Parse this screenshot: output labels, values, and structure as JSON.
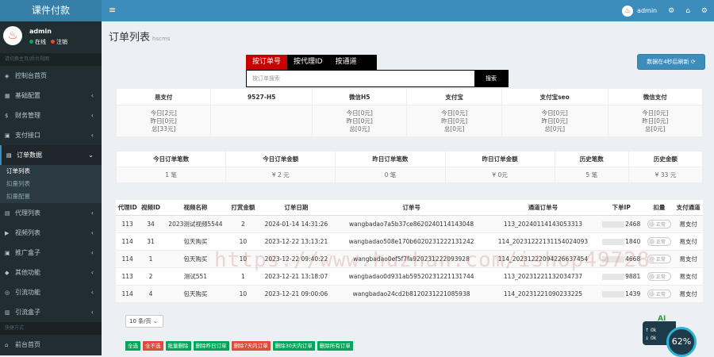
{
  "app": {
    "brand": "课件付款",
    "user": "admin"
  },
  "sidebar": {
    "user_name": "admin",
    "status_online": "在线",
    "status_logout": "注销",
    "section_main": "请切换主页/后台视图",
    "items": [
      {
        "label": "控制台首页",
        "icon": "dashboard-icon"
      },
      {
        "label": "基础配置",
        "icon": "settings-icon"
      },
      {
        "label": "财务管理",
        "icon": "finance-icon"
      },
      {
        "label": "支付接口",
        "icon": "payment-icon"
      },
      {
        "label": "订单数据",
        "icon": "order-icon"
      },
      {
        "label": "代理列表",
        "icon": "agent-icon"
      },
      {
        "label": "视频列表",
        "icon": "video-icon"
      },
      {
        "label": "推广盒子",
        "icon": "promo-icon"
      },
      {
        "label": "其他功能",
        "icon": "other-icon"
      },
      {
        "label": "引流功能",
        "icon": "traffic-icon"
      },
      {
        "label": "引流盒子",
        "icon": "box-icon"
      }
    ],
    "sub_items": [
      "订单列表",
      "扣量列表",
      "扣量配置"
    ],
    "section_quick": "快捷方式",
    "front_home": "前台首页"
  },
  "page": {
    "title": "订单列表",
    "subtitle": "hscms"
  },
  "search": {
    "tabs": [
      "按订单号",
      "按代理ID",
      "按通道"
    ],
    "placeholder": "按订单搜索",
    "button": "搜索"
  },
  "refresh_button": "数据在4秒后刷新",
  "pay_channels": {
    "headers": [
      "易支付",
      "9527-H5",
      "微信H5",
      "支付宝",
      "支付宝seo",
      "微信支付"
    ],
    "rows": [
      [
        "今日[2元]",
        "",
        "今日[0元]",
        "今日[0元]",
        "今日[0元]",
        "今日[0元]"
      ],
      [
        "昨日[0元]",
        "",
        "昨日[0元]",
        "昨日[0元]",
        "昨日[0元]",
        "昨日[0元]"
      ],
      [
        "总[33元]",
        "",
        "总[0元]",
        "总[0元]",
        "总[0元]",
        "总[0元]"
      ]
    ]
  },
  "stats": {
    "headers": [
      "今日订单笔数",
      "今日订单金额",
      "昨日订单笔数",
      "昨日订单金额",
      "历史笔数",
      "历史金额"
    ],
    "values": [
      "1 笔",
      "¥ 2 元",
      "0 笔",
      "¥ 0元",
      "5 笔",
      "¥ 33 元"
    ]
  },
  "orders": {
    "headers": [
      "代理ID",
      "视频ID",
      "视频名称",
      "打赏金额",
      "订单日期",
      "订单号",
      "通道订单号",
      "下单IP",
      "扣量",
      "支付通道"
    ],
    "rows": [
      [
        "113",
        "34",
        "2023测试视频5544",
        "2",
        "2024-01-14 14:31:26",
        "wangbadao7a5b37ce8620240114143048",
        "113_20240114143053313",
        "2468",
        "正常",
        "易支付"
      ],
      [
        "114",
        "31",
        "包天购买",
        "10",
        "2023-12-22 13:13:21",
        "wangbadao508e170b6020231222131242",
        "114_20231222131154024093",
        "1840",
        "正常",
        "易支付"
      ],
      [
        "114",
        "1",
        "包天购买",
        "10",
        "2023-12-22 09:40:22",
        "wangbadao0ef5f7fa920231222093928",
        "114_20231222094226637454",
        "4668",
        "正常",
        "易支付"
      ],
      [
        "113",
        "2",
        "测试551",
        "1",
        "2023-12-21 13:18:07",
        "wangbadao0d931ab59520231221131744",
        "113_20231221132034737",
        "9881",
        "正常",
        "易支付"
      ],
      [
        "114",
        "4",
        "包天购买",
        "10",
        "2023-12-21 09:00:06",
        "wangbadao24cd2b8120231221085938",
        "114_20231221090233225",
        "1439",
        "正常",
        "易支付"
      ]
    ]
  },
  "pager": {
    "page_size": "10 条/页"
  },
  "bulk_buttons": [
    {
      "label": "全选",
      "color": "#00a65a"
    },
    {
      "label": "全不选",
      "color": "#dd4b39"
    },
    {
      "label": "批量删除",
      "color": "#00a65a"
    },
    {
      "label": "删除昨日订单",
      "color": "#00a65a"
    },
    {
      "label": "删除7天内订单",
      "color": "#dd4b39"
    },
    {
      "label": "删除30天内订单",
      "color": "#00a65a"
    },
    {
      "label": "删除所有订单",
      "color": "#00a65a"
    }
  ],
  "watermark": "https://www.huzhan.com/ishop49728",
  "gauge": {
    "value": "62%",
    "label": "AI",
    "up": "0k",
    "down": "0k"
  },
  "colors": {
    "primary": "#3c8dbc",
    "sidebar": "#222d32",
    "tab_active": "#c80000",
    "success": "#00a65a",
    "danger": "#dd4b39"
  }
}
